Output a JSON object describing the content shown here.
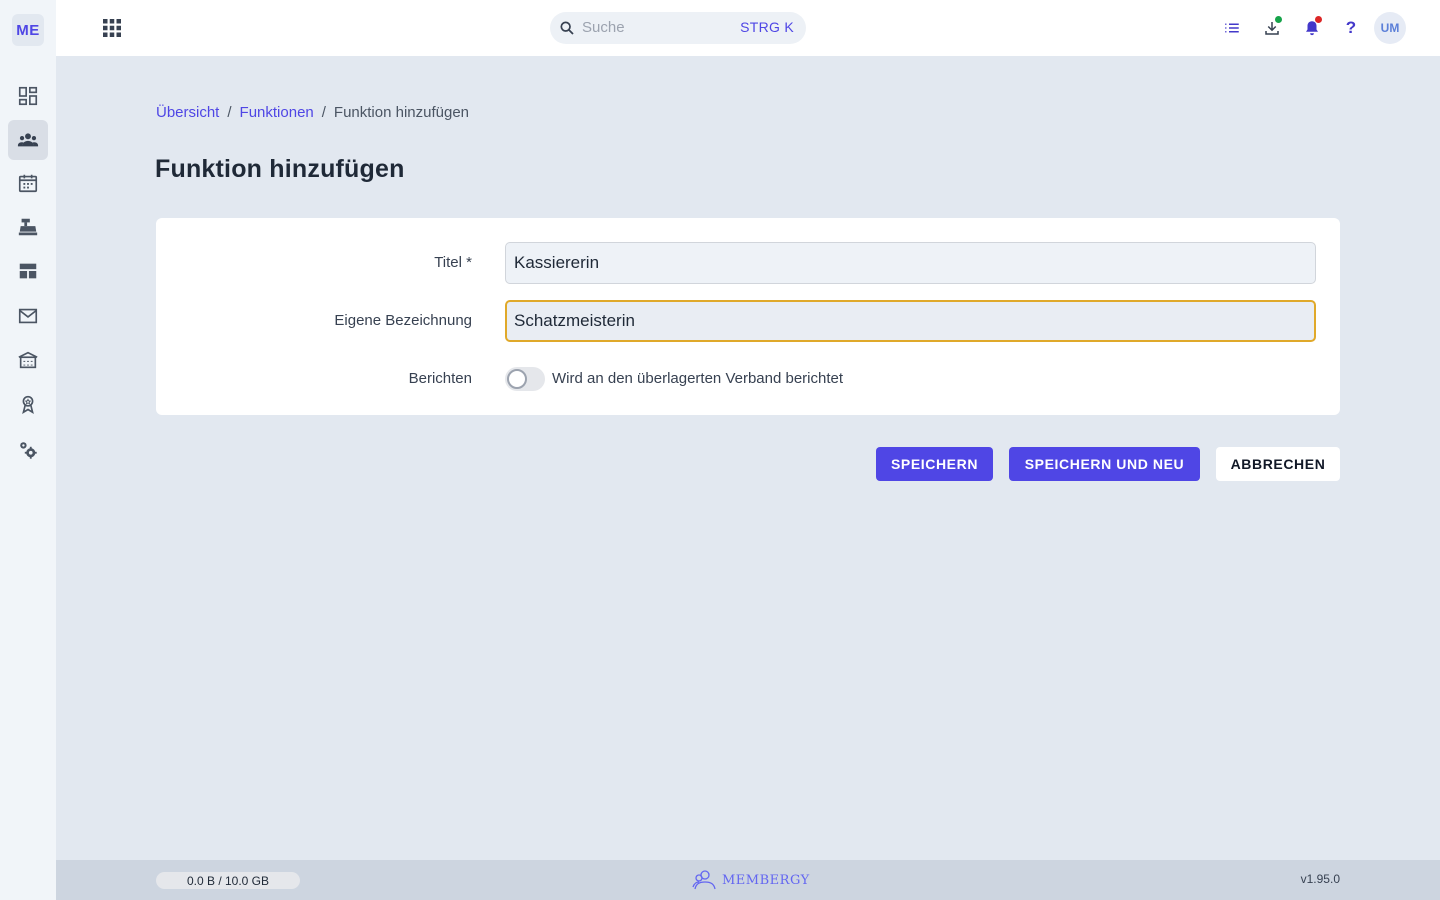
{
  "sidebar": {
    "logo": "ME",
    "items": [
      {
        "icon": "dashboard-icon"
      },
      {
        "icon": "members-icon",
        "active": true
      },
      {
        "icon": "calendar-icon"
      },
      {
        "icon": "cash-register-icon"
      },
      {
        "icon": "layout-icon"
      },
      {
        "icon": "mail-icon"
      },
      {
        "icon": "building-icon"
      },
      {
        "icon": "award-icon"
      },
      {
        "icon": "settings-icon"
      }
    ]
  },
  "topbar": {
    "search_placeholder": "Suche",
    "search_shortcut": "STRG K",
    "help": "?",
    "avatar": "UM",
    "download_dot_color": "#16a34a",
    "notification_dot_color": "#dc2626"
  },
  "breadcrumb": {
    "items": [
      "Übersicht",
      "Funktionen",
      "Funktion hinzufügen"
    ],
    "separator": "/"
  },
  "page": {
    "title": "Funktion hinzufügen"
  },
  "form": {
    "title_label": "Titel *",
    "title_value": "Kassiererin",
    "custom_label": "Eigene Bezeichnung",
    "custom_value": "Schatzmeisterin",
    "report_label": "Berichten",
    "report_text": "Wird an den überlagerten Verband berichtet",
    "report_enabled": false
  },
  "actions": {
    "save": "SPEICHERN",
    "save_new": "SPEICHERN UND NEU",
    "cancel": "ABBRECHEN"
  },
  "footer": {
    "storage": "0.0 B / 10.0 GB",
    "brand": "MEMBERGY",
    "version": "v1.95.0"
  },
  "colors": {
    "accent": "#4f46e5",
    "focus_border": "#e0a92a"
  }
}
